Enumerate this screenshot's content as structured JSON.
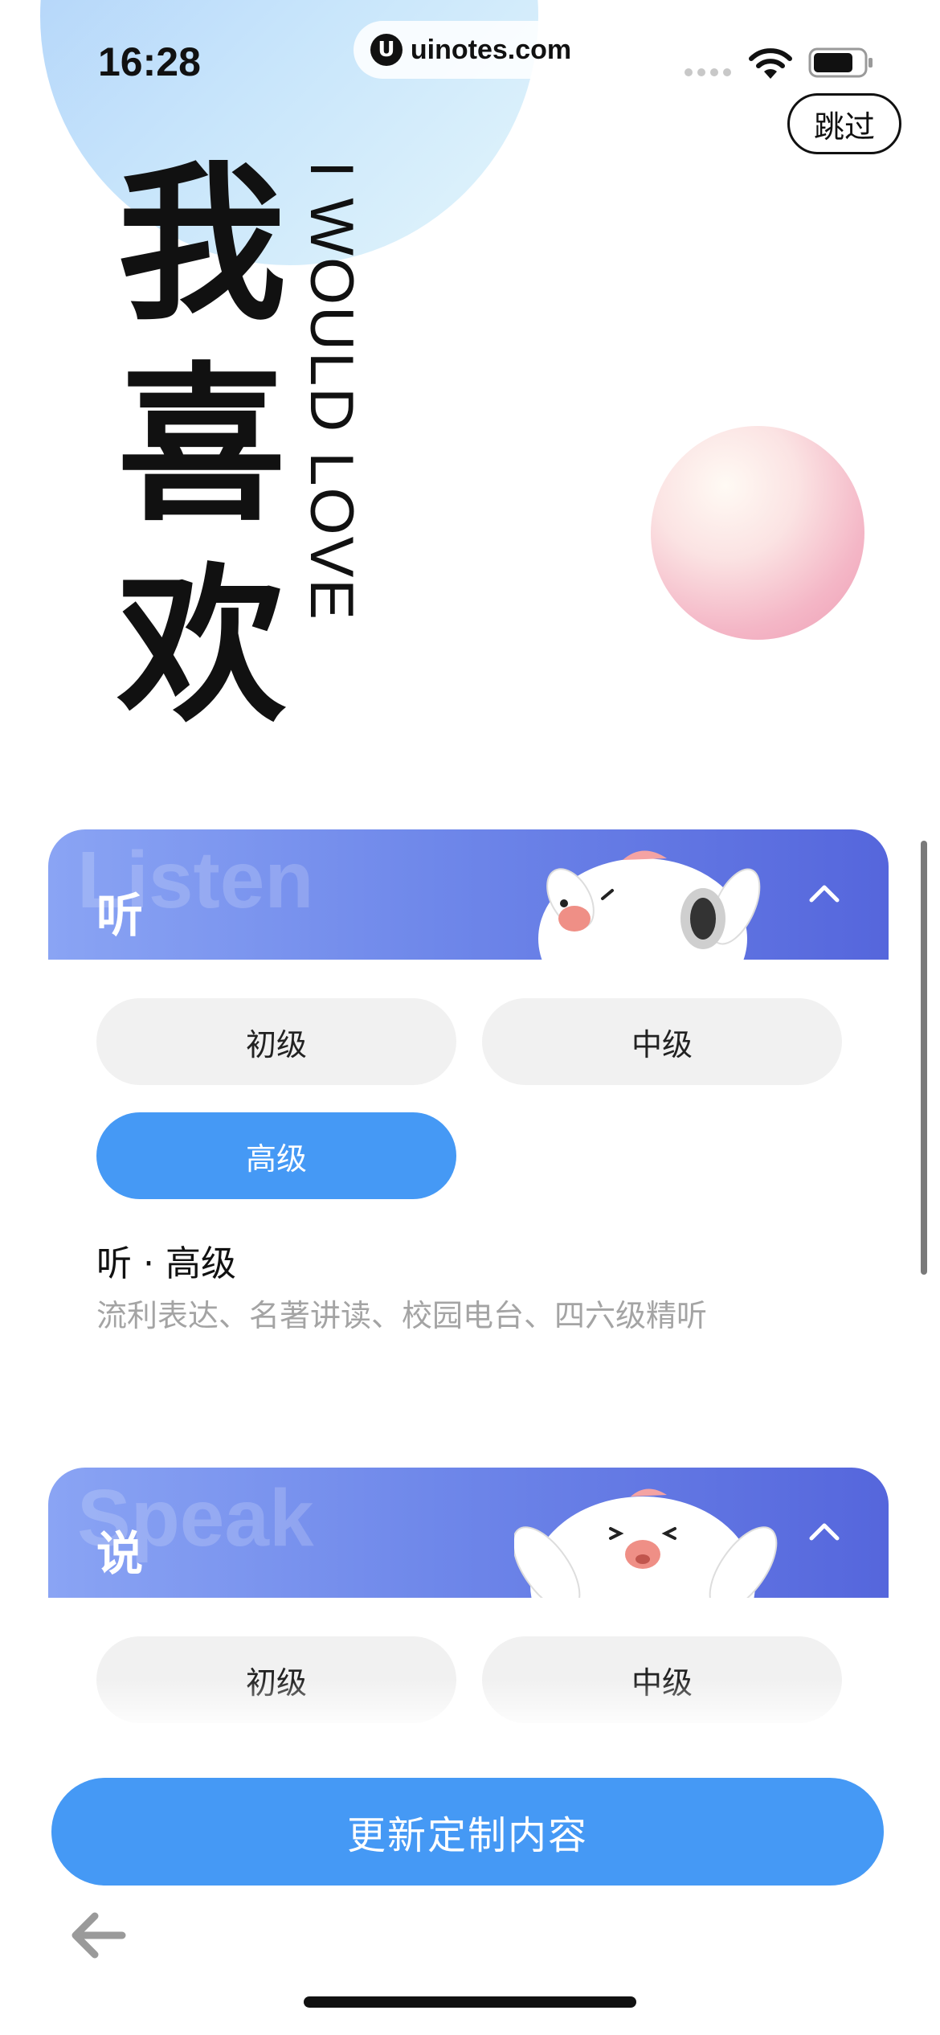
{
  "status_bar": {
    "time": "16:28",
    "url": "uinotes.com",
    "url_logo": "U",
    "icons": [
      "signal-dots-icon",
      "wifi-icon",
      "battery-icon"
    ]
  },
  "skip_label": "跳过",
  "hero": {
    "chars": [
      "我",
      "喜",
      "欢"
    ],
    "english": "I WOULD LOVE"
  },
  "sections": [
    {
      "watermark": "Listen",
      "title": "听",
      "levels": [
        "初级",
        "中级",
        "高级"
      ],
      "selected": "高级",
      "detail_title": "听 · 高级",
      "detail_desc": "流利表达、名著讲读、校园电台、四六级精听"
    },
    {
      "watermark": "Speak",
      "title": "说",
      "levels": [
        "初级",
        "中级"
      ]
    }
  ],
  "update_button": "更新定制内容",
  "colors": {
    "accent": "#4599f5",
    "header_start": "#8aa4f4",
    "header_end": "#5566dc",
    "pill_bg": "#f1f1f1",
    "pink_ball": "#ee9db4"
  }
}
